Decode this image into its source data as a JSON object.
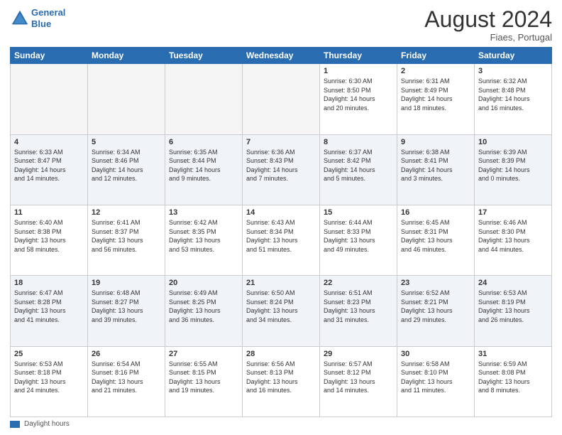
{
  "header": {
    "logo_line1": "General",
    "logo_line2": "Blue",
    "month": "August 2024",
    "location": "Fiaes, Portugal"
  },
  "footer": {
    "legend_label": "Daylight hours"
  },
  "days_of_week": [
    "Sunday",
    "Monday",
    "Tuesday",
    "Wednesday",
    "Thursday",
    "Friday",
    "Saturday"
  ],
  "weeks": [
    [
      {
        "day": "",
        "info": ""
      },
      {
        "day": "",
        "info": ""
      },
      {
        "day": "",
        "info": ""
      },
      {
        "day": "",
        "info": ""
      },
      {
        "day": "1",
        "info": "Sunrise: 6:30 AM\nSunset: 8:50 PM\nDaylight: 14 hours\nand 20 minutes."
      },
      {
        "day": "2",
        "info": "Sunrise: 6:31 AM\nSunset: 8:49 PM\nDaylight: 14 hours\nand 18 minutes."
      },
      {
        "day": "3",
        "info": "Sunrise: 6:32 AM\nSunset: 8:48 PM\nDaylight: 14 hours\nand 16 minutes."
      }
    ],
    [
      {
        "day": "4",
        "info": "Sunrise: 6:33 AM\nSunset: 8:47 PM\nDaylight: 14 hours\nand 14 minutes."
      },
      {
        "day": "5",
        "info": "Sunrise: 6:34 AM\nSunset: 8:46 PM\nDaylight: 14 hours\nand 12 minutes."
      },
      {
        "day": "6",
        "info": "Sunrise: 6:35 AM\nSunset: 8:44 PM\nDaylight: 14 hours\nand 9 minutes."
      },
      {
        "day": "7",
        "info": "Sunrise: 6:36 AM\nSunset: 8:43 PM\nDaylight: 14 hours\nand 7 minutes."
      },
      {
        "day": "8",
        "info": "Sunrise: 6:37 AM\nSunset: 8:42 PM\nDaylight: 14 hours\nand 5 minutes."
      },
      {
        "day": "9",
        "info": "Sunrise: 6:38 AM\nSunset: 8:41 PM\nDaylight: 14 hours\nand 3 minutes."
      },
      {
        "day": "10",
        "info": "Sunrise: 6:39 AM\nSunset: 8:39 PM\nDaylight: 14 hours\nand 0 minutes."
      }
    ],
    [
      {
        "day": "11",
        "info": "Sunrise: 6:40 AM\nSunset: 8:38 PM\nDaylight: 13 hours\nand 58 minutes."
      },
      {
        "day": "12",
        "info": "Sunrise: 6:41 AM\nSunset: 8:37 PM\nDaylight: 13 hours\nand 56 minutes."
      },
      {
        "day": "13",
        "info": "Sunrise: 6:42 AM\nSunset: 8:35 PM\nDaylight: 13 hours\nand 53 minutes."
      },
      {
        "day": "14",
        "info": "Sunrise: 6:43 AM\nSunset: 8:34 PM\nDaylight: 13 hours\nand 51 minutes."
      },
      {
        "day": "15",
        "info": "Sunrise: 6:44 AM\nSunset: 8:33 PM\nDaylight: 13 hours\nand 49 minutes."
      },
      {
        "day": "16",
        "info": "Sunrise: 6:45 AM\nSunset: 8:31 PM\nDaylight: 13 hours\nand 46 minutes."
      },
      {
        "day": "17",
        "info": "Sunrise: 6:46 AM\nSunset: 8:30 PM\nDaylight: 13 hours\nand 44 minutes."
      }
    ],
    [
      {
        "day": "18",
        "info": "Sunrise: 6:47 AM\nSunset: 8:28 PM\nDaylight: 13 hours\nand 41 minutes."
      },
      {
        "day": "19",
        "info": "Sunrise: 6:48 AM\nSunset: 8:27 PM\nDaylight: 13 hours\nand 39 minutes."
      },
      {
        "day": "20",
        "info": "Sunrise: 6:49 AM\nSunset: 8:25 PM\nDaylight: 13 hours\nand 36 minutes."
      },
      {
        "day": "21",
        "info": "Sunrise: 6:50 AM\nSunset: 8:24 PM\nDaylight: 13 hours\nand 34 minutes."
      },
      {
        "day": "22",
        "info": "Sunrise: 6:51 AM\nSunset: 8:23 PM\nDaylight: 13 hours\nand 31 minutes."
      },
      {
        "day": "23",
        "info": "Sunrise: 6:52 AM\nSunset: 8:21 PM\nDaylight: 13 hours\nand 29 minutes."
      },
      {
        "day": "24",
        "info": "Sunrise: 6:53 AM\nSunset: 8:19 PM\nDaylight: 13 hours\nand 26 minutes."
      }
    ],
    [
      {
        "day": "25",
        "info": "Sunrise: 6:53 AM\nSunset: 8:18 PM\nDaylight: 13 hours\nand 24 minutes."
      },
      {
        "day": "26",
        "info": "Sunrise: 6:54 AM\nSunset: 8:16 PM\nDaylight: 13 hours\nand 21 minutes."
      },
      {
        "day": "27",
        "info": "Sunrise: 6:55 AM\nSunset: 8:15 PM\nDaylight: 13 hours\nand 19 minutes."
      },
      {
        "day": "28",
        "info": "Sunrise: 6:56 AM\nSunset: 8:13 PM\nDaylight: 13 hours\nand 16 minutes."
      },
      {
        "day": "29",
        "info": "Sunrise: 6:57 AM\nSunset: 8:12 PM\nDaylight: 13 hours\nand 14 minutes."
      },
      {
        "day": "30",
        "info": "Sunrise: 6:58 AM\nSunset: 8:10 PM\nDaylight: 13 hours\nand 11 minutes."
      },
      {
        "day": "31",
        "info": "Sunrise: 6:59 AM\nSunset: 8:08 PM\nDaylight: 13 hours\nand 8 minutes."
      }
    ]
  ]
}
